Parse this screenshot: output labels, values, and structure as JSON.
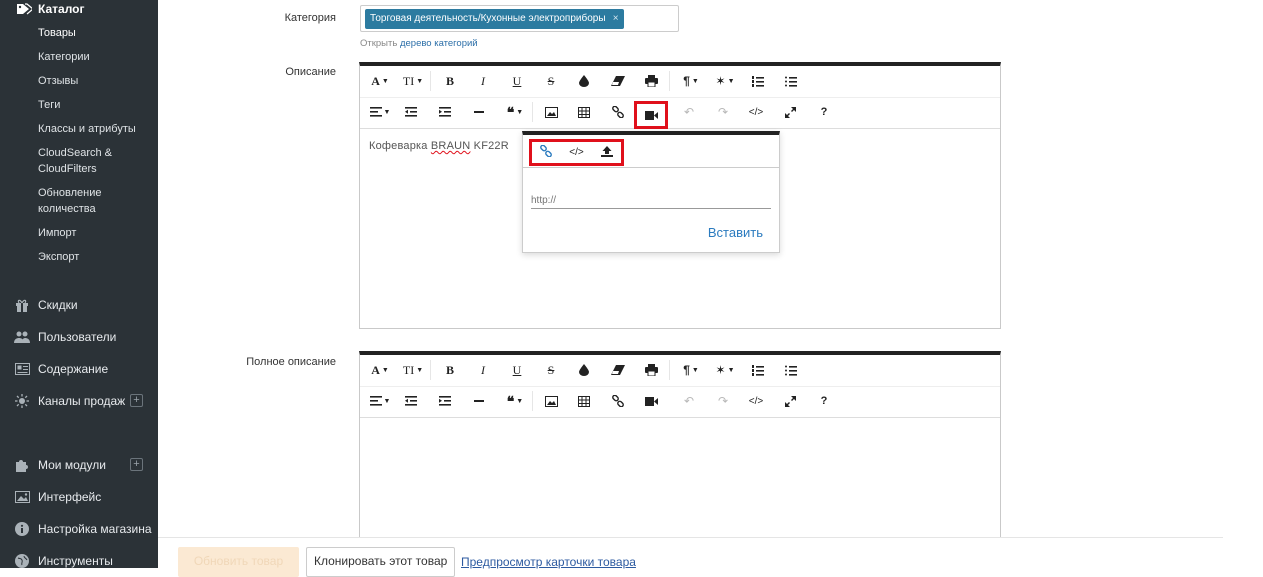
{
  "sidebar": {
    "catalog_title": "Каталог",
    "catalog_items": [
      "Товары",
      "Категории",
      "Отзывы",
      "Теги",
      "Классы и атрибуты",
      "CloudSearch &",
      "CloudFilters",
      "Обновление",
      "количества",
      "Импорт",
      "Экспорт"
    ],
    "main_items": [
      {
        "label": "Скидки",
        "icon": "gift-icon"
      },
      {
        "label": "Пользователи",
        "icon": "users-icon"
      },
      {
        "label": "Содержание",
        "icon": "newspaper-icon"
      },
      {
        "label": "Каналы продаж",
        "icon": "sun-icon"
      },
      {
        "label": "Мои модули",
        "icon": "puzzle-icon"
      },
      {
        "label": "Интерфейс",
        "icon": "image-icon"
      },
      {
        "label": "Настройка магазина",
        "icon": "info-icon"
      },
      {
        "label": "Инструменты",
        "icon": "globe-icon"
      }
    ],
    "plus": "+"
  },
  "form": {
    "category_label": "Категория",
    "category_chip": "Торговая деятельность/Кухонные электроприборы",
    "chip_remove": "×",
    "hint_prefix": "Открыть",
    "hint_link": "дерево категорий",
    "description_label": "Описание",
    "full_description_label": "Полное описание"
  },
  "editor": {
    "content_prefix": "Кофеварка ",
    "content_brand": "BRAUN",
    "content_suffix": " KF22R",
    "toolbar": {
      "font": "A",
      "textsize": "TI",
      "bold": "B",
      "italic": "I",
      "underline": "U",
      "strike": "S",
      "color": "●",
      "eraser": "◆",
      "print": "⎙",
      "paragraph": "¶",
      "magic": "✶",
      "ol": "≡",
      "ul": "≡",
      "align": "≡",
      "indent": "⇥",
      "outdent": "⇤",
      "hr": "—",
      "quote": "❝",
      "image": "▣",
      "table": "▦",
      "link": "∞",
      "video": "■",
      "undo": "↶",
      "redo": "↷",
      "code": "</>",
      "fullscreen": "⤢",
      "help": "?"
    }
  },
  "popover": {
    "placeholder": "http://",
    "insert": "Вставить"
  },
  "bottom": {
    "update": "Обновить товар",
    "clone": "Клонировать этот товар",
    "preview": "Предпросмотр карточки товара"
  },
  "colors": {
    "sidebar_bg": "#2b3237",
    "chip_bg": "#2c7ba0",
    "highlight": "#e0101b",
    "link": "#2b7bbf"
  }
}
